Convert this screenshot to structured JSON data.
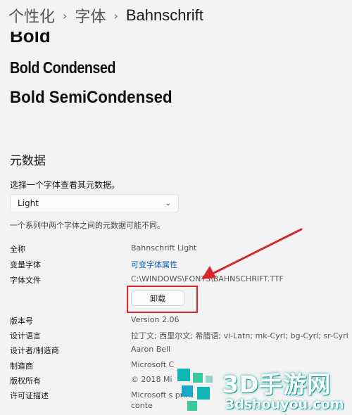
{
  "breadcrumb": {
    "items": [
      "个性化",
      "字体"
    ],
    "current": "Bahnschrift"
  },
  "preview": {
    "bold": "Bold",
    "bold_condensed": "Bold Condensed",
    "bold_semicondensed": "Bold SemiCondensed"
  },
  "metadata": {
    "title": "元数据",
    "hint": "选择一个字体查看其元数据。",
    "selected_face": "Light",
    "note": "一个系列中两个字体之间的元数据可能不同。",
    "rows": [
      {
        "key": "全称",
        "value": "Bahnschrift Light"
      },
      {
        "key": "变量字体",
        "value": "可变字体属性"
      },
      {
        "key": "字体文件",
        "value": "C:\\WINDOWS\\FONTS\\BAHNSCHRIFT.TTF"
      },
      {
        "key": "版本号",
        "value": "Version 2.06"
      },
      {
        "key": "设计语言",
        "value": "拉丁文; 西里尔文; 希腊语; vi-Latn; mk-Cyrl; bg-Cyrl; sr-Cyrl"
      },
      {
        "key": "设计者/制造商",
        "value": "Aaron Bell"
      },
      {
        "key": "制造商",
        "value": "Microsoft C"
      },
      {
        "key": "版权所有",
        "value": "© 2018 Mi"
      },
      {
        "key": "许可证描述",
        "value": "Microsoft s print conte"
      }
    ],
    "uninstall_label": "卸载"
  },
  "colors": {
    "accent_link": "#0a5fb4",
    "highlight_red": "#d9262b"
  },
  "watermark": {
    "title": "3D手游网",
    "url": "3dshouyou.com"
  }
}
